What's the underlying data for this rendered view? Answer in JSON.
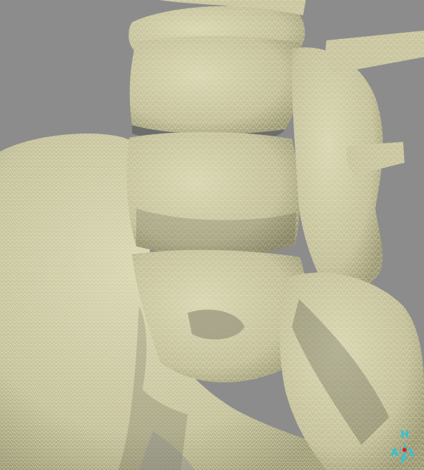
{
  "orientation": {
    "top": "H",
    "left": "A",
    "right": "L",
    "bottom": "F",
    "label_color": "#2ec4d6",
    "marker_color": "#e02020"
  },
  "colors": {
    "background": "#8c8c8c",
    "bone_fill": "#cfcca6",
    "bone_shade": "#a8a57f",
    "mesh_line": "#f2f0d2",
    "deep_shadow": "#5e5c45"
  }
}
